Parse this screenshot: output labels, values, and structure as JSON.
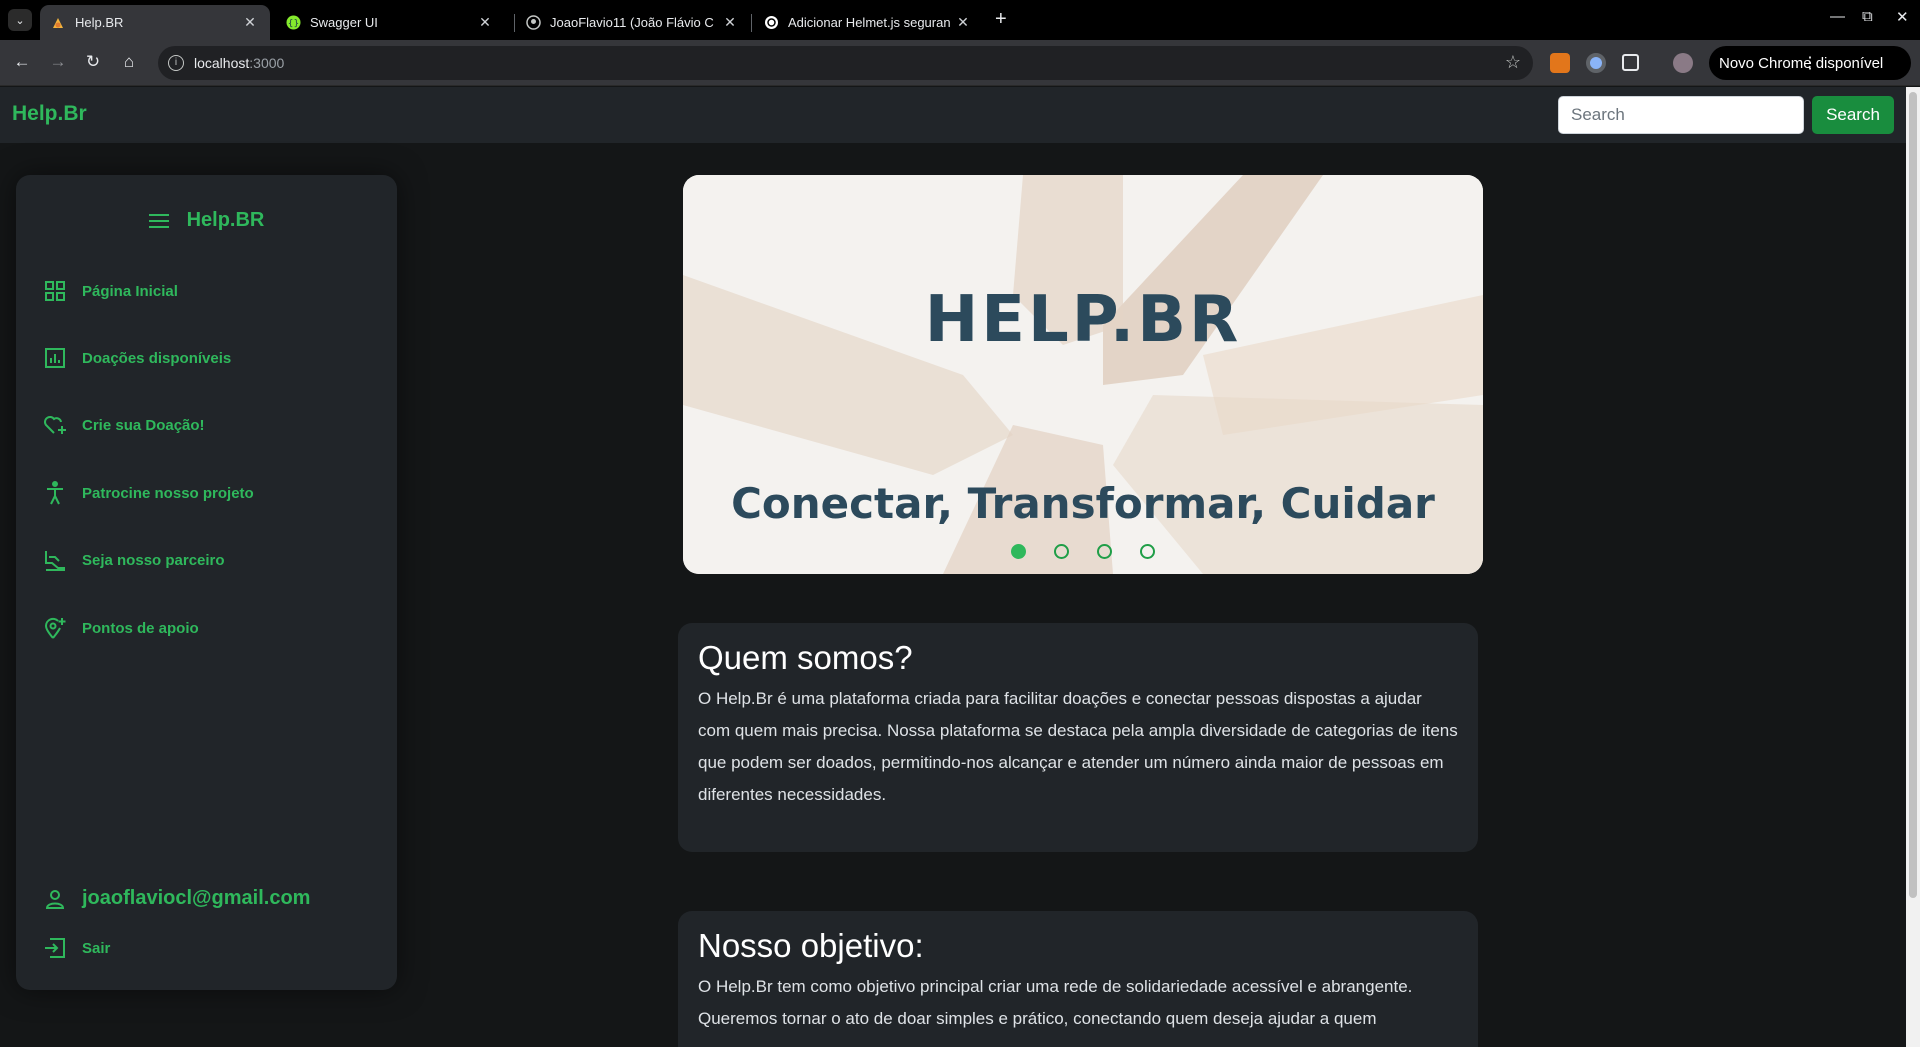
{
  "browser": {
    "tabs": [
      {
        "title": "Help.BR",
        "active": true
      },
      {
        "title": "Swagger UI",
        "active": false
      },
      {
        "title": "JoaoFlavio11 (João Flávio C",
        "active": false
      },
      {
        "title": "Adicionar Helmet.js seguran",
        "active": false
      }
    ],
    "url_host": "localhost",
    "url_port": ":3000",
    "update_label": "Novo Chrome disponível"
  },
  "navbar": {
    "brand": "Help.Br",
    "search_placeholder": "Search",
    "search_button": "Search"
  },
  "sidebar": {
    "title": "Help.BR",
    "items": [
      {
        "label": "Página Inicial",
        "icon": "grid-icon"
      },
      {
        "label": "Doações disponíveis",
        "icon": "bar-chart-icon"
      },
      {
        "label": "Crie sua Doação!",
        "icon": "heart-plus-icon"
      },
      {
        "label": "Patrocine nosso projeto",
        "icon": "accessibility-icon"
      },
      {
        "label": "Seja nosso parceiro",
        "icon": "handshake-icon"
      },
      {
        "label": "Pontos de apoio",
        "icon": "location-plus-icon"
      }
    ],
    "user_email": "joaoflaviocl@gmail.com",
    "logout_label": "Sair"
  },
  "carousel": {
    "title": "HELP.BR",
    "subtitle": "Conectar, Transformar, Cuidar",
    "slide_count": 4,
    "active_slide": 1
  },
  "about": {
    "heading": "Quem somos?",
    "text": "O Help.Br é uma plataforma criada para facilitar doações e conectar pessoas dispostas a ajudar com quem mais precisa. Nossa plataforma se destaca pela ampla diversidade de categorias de itens que podem ser doados, permitindo-nos alcançar e atender um número ainda maior de pessoas em diferentes necessidades."
  },
  "goal": {
    "heading": "Nosso objetivo:",
    "text": "O Help.Br tem como objetivo principal criar uma rede de solidariedade acessível e abrangente. Queremos tornar o ato de doar simples e prático, conectando quem deseja ajudar a quem"
  },
  "colors": {
    "accent": "#2fb85c",
    "button": "#198d3e",
    "panel": "#212529",
    "background": "#141617"
  }
}
